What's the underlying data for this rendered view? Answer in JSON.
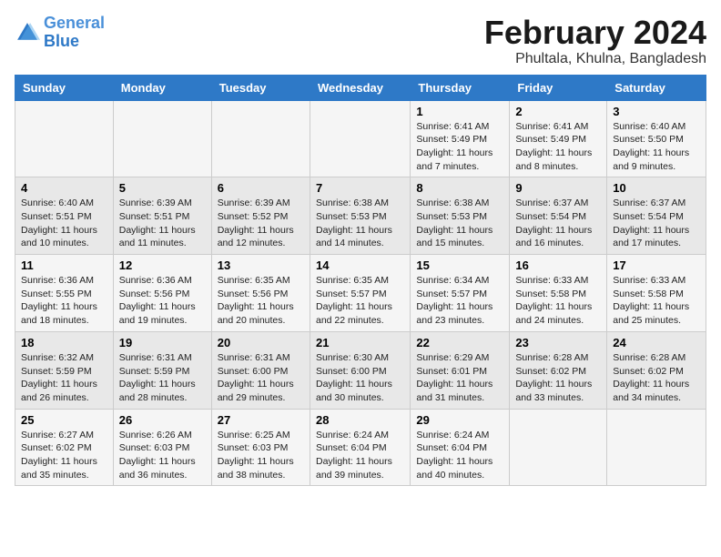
{
  "header": {
    "logo_line1": "General",
    "logo_line2": "Blue",
    "title": "February 2024",
    "subtitle": "Phultala, Khulna, Bangladesh"
  },
  "days_of_week": [
    "Sunday",
    "Monday",
    "Tuesday",
    "Wednesday",
    "Thursday",
    "Friday",
    "Saturday"
  ],
  "weeks": [
    [
      {
        "day": "",
        "info": ""
      },
      {
        "day": "",
        "info": ""
      },
      {
        "day": "",
        "info": ""
      },
      {
        "day": "",
        "info": ""
      },
      {
        "day": "1",
        "info": "Sunrise: 6:41 AM\nSunset: 5:49 PM\nDaylight: 11 hours and 7 minutes."
      },
      {
        "day": "2",
        "info": "Sunrise: 6:41 AM\nSunset: 5:49 PM\nDaylight: 11 hours and 8 minutes."
      },
      {
        "day": "3",
        "info": "Sunrise: 6:40 AM\nSunset: 5:50 PM\nDaylight: 11 hours and 9 minutes."
      }
    ],
    [
      {
        "day": "4",
        "info": "Sunrise: 6:40 AM\nSunset: 5:51 PM\nDaylight: 11 hours and 10 minutes."
      },
      {
        "day": "5",
        "info": "Sunrise: 6:39 AM\nSunset: 5:51 PM\nDaylight: 11 hours and 11 minutes."
      },
      {
        "day": "6",
        "info": "Sunrise: 6:39 AM\nSunset: 5:52 PM\nDaylight: 11 hours and 12 minutes."
      },
      {
        "day": "7",
        "info": "Sunrise: 6:38 AM\nSunset: 5:53 PM\nDaylight: 11 hours and 14 minutes."
      },
      {
        "day": "8",
        "info": "Sunrise: 6:38 AM\nSunset: 5:53 PM\nDaylight: 11 hours and 15 minutes."
      },
      {
        "day": "9",
        "info": "Sunrise: 6:37 AM\nSunset: 5:54 PM\nDaylight: 11 hours and 16 minutes."
      },
      {
        "day": "10",
        "info": "Sunrise: 6:37 AM\nSunset: 5:54 PM\nDaylight: 11 hours and 17 minutes."
      }
    ],
    [
      {
        "day": "11",
        "info": "Sunrise: 6:36 AM\nSunset: 5:55 PM\nDaylight: 11 hours and 18 minutes."
      },
      {
        "day": "12",
        "info": "Sunrise: 6:36 AM\nSunset: 5:56 PM\nDaylight: 11 hours and 19 minutes."
      },
      {
        "day": "13",
        "info": "Sunrise: 6:35 AM\nSunset: 5:56 PM\nDaylight: 11 hours and 20 minutes."
      },
      {
        "day": "14",
        "info": "Sunrise: 6:35 AM\nSunset: 5:57 PM\nDaylight: 11 hours and 22 minutes."
      },
      {
        "day": "15",
        "info": "Sunrise: 6:34 AM\nSunset: 5:57 PM\nDaylight: 11 hours and 23 minutes."
      },
      {
        "day": "16",
        "info": "Sunrise: 6:33 AM\nSunset: 5:58 PM\nDaylight: 11 hours and 24 minutes."
      },
      {
        "day": "17",
        "info": "Sunrise: 6:33 AM\nSunset: 5:58 PM\nDaylight: 11 hours and 25 minutes."
      }
    ],
    [
      {
        "day": "18",
        "info": "Sunrise: 6:32 AM\nSunset: 5:59 PM\nDaylight: 11 hours and 26 minutes."
      },
      {
        "day": "19",
        "info": "Sunrise: 6:31 AM\nSunset: 5:59 PM\nDaylight: 11 hours and 28 minutes."
      },
      {
        "day": "20",
        "info": "Sunrise: 6:31 AM\nSunset: 6:00 PM\nDaylight: 11 hours and 29 minutes."
      },
      {
        "day": "21",
        "info": "Sunrise: 6:30 AM\nSunset: 6:00 PM\nDaylight: 11 hours and 30 minutes."
      },
      {
        "day": "22",
        "info": "Sunrise: 6:29 AM\nSunset: 6:01 PM\nDaylight: 11 hours and 31 minutes."
      },
      {
        "day": "23",
        "info": "Sunrise: 6:28 AM\nSunset: 6:02 PM\nDaylight: 11 hours and 33 minutes."
      },
      {
        "day": "24",
        "info": "Sunrise: 6:28 AM\nSunset: 6:02 PM\nDaylight: 11 hours and 34 minutes."
      }
    ],
    [
      {
        "day": "25",
        "info": "Sunrise: 6:27 AM\nSunset: 6:02 PM\nDaylight: 11 hours and 35 minutes."
      },
      {
        "day": "26",
        "info": "Sunrise: 6:26 AM\nSunset: 6:03 PM\nDaylight: 11 hours and 36 minutes."
      },
      {
        "day": "27",
        "info": "Sunrise: 6:25 AM\nSunset: 6:03 PM\nDaylight: 11 hours and 38 minutes."
      },
      {
        "day": "28",
        "info": "Sunrise: 6:24 AM\nSunset: 6:04 PM\nDaylight: 11 hours and 39 minutes."
      },
      {
        "day": "29",
        "info": "Sunrise: 6:24 AM\nSunset: 6:04 PM\nDaylight: 11 hours and 40 minutes."
      },
      {
        "day": "",
        "info": ""
      },
      {
        "day": "",
        "info": ""
      }
    ]
  ]
}
